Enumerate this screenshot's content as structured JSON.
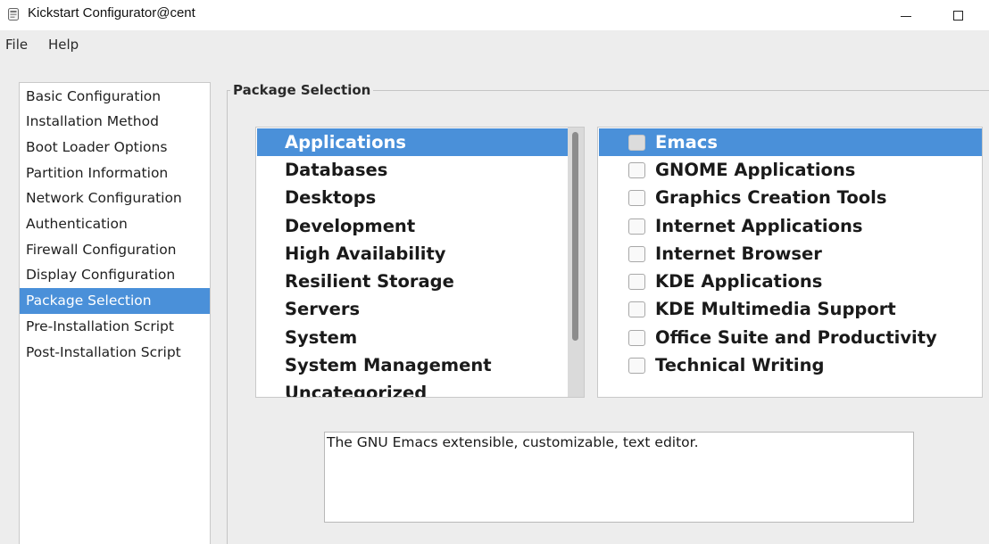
{
  "window": {
    "title": "Kickstart Configurator@cent",
    "icon": "kickstart-app-icon",
    "controls": [
      "minimize-icon",
      "maximize-icon"
    ]
  },
  "menubar": {
    "items": [
      "File",
      "Help"
    ]
  },
  "sidebar": {
    "selected": "Package Selection",
    "items": [
      "Basic Configuration",
      "Installation Method",
      "Boot Loader Options",
      "Partition Information",
      "Network Configuration",
      "Authentication",
      "Firewall Configuration",
      "Display Configuration",
      "Package Selection",
      "Pre-Installation Script",
      "Post-Installation Script"
    ]
  },
  "package_selection": {
    "frame_label": "Package Selection",
    "groups": {
      "selected": "Applications",
      "items": [
        "Applications",
        "Databases",
        "Desktops",
        "Development",
        "High Availability",
        "Resilient Storage",
        "Servers",
        "System",
        "System Management",
        "Uncategorized"
      ]
    },
    "packages": {
      "selected": "Emacs",
      "items": [
        {
          "label": "Emacs",
          "checked": false
        },
        {
          "label": "GNOME Applications",
          "checked": false
        },
        {
          "label": "Graphics Creation Tools",
          "checked": false
        },
        {
          "label": "Internet Applications",
          "checked": false
        },
        {
          "label": "Internet Browser",
          "checked": false
        },
        {
          "label": "KDE Applications",
          "checked": false
        },
        {
          "label": "KDE Multimedia Support",
          "checked": false
        },
        {
          "label": "Office Suite and Productivity",
          "checked": false
        },
        {
          "label": "Technical Writing",
          "checked": false
        }
      ]
    },
    "description": "The GNU Emacs extensible, customizable, text editor."
  },
  "colors": {
    "selection": "#4a90d9",
    "background": "#ededed",
    "list_background": "#ffffff"
  }
}
